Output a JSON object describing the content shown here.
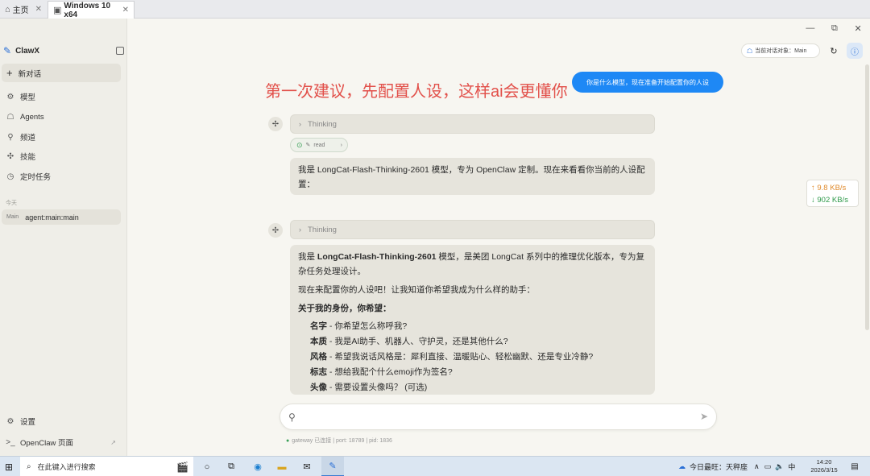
{
  "host_tabs": [
    {
      "label": "主页",
      "icon": "home-icon",
      "close": "✕"
    },
    {
      "label": "Windows 10 x64",
      "icon": "vm-icon",
      "close": "✕"
    }
  ],
  "window": {
    "minimize": "—",
    "restore": "⧉",
    "close": "✕"
  },
  "sidebar": {
    "brand": "ClawX",
    "new_chat": "新对话",
    "nav": [
      {
        "label": "模型",
        "icon": "cpu-icon"
      },
      {
        "label": "Agents",
        "icon": "bot-icon"
      },
      {
        "label": "频道",
        "icon": "network-icon"
      },
      {
        "label": "技能",
        "icon": "puzzle-icon"
      },
      {
        "label": "定时任务",
        "icon": "clock-icon"
      }
    ],
    "section_today": "今天",
    "session": {
      "tag": "Main",
      "label": "agent:main:main"
    },
    "settings": "设置",
    "openclaw_page": "OpenClaw 页面"
  },
  "header": {
    "target_label": "当前对话对象：Main",
    "refresh_icon": "refresh-icon",
    "info_icon": "info-icon"
  },
  "annotation": "第一次建议，先配置人设，这样ai会更懂你",
  "user_message": "你是什么模型，现在准备开始配置你的人设",
  "conversation": {
    "thinking_label": "Thinking",
    "tool_chip": "read",
    "msg1": "我是 LongCat-Flash-Thinking-2601 模型，专为 OpenClaw 定制。现在来看看你当前的人设配置：",
    "msg2": {
      "intro_prefix": "我是 ",
      "intro_model": "LongCat-Flash-Thinking-2601",
      "intro_suffix": " 模型，是美团 LongCat 系列中的推理优化版本，专为复杂任务处理设计。",
      "line2": "现在来配置你的人设吧！让我知道你希望我成为什么样的助手：",
      "heading": "关于我的身份，你希望：",
      "items": [
        {
          "key": "名字",
          "text": " - 你希望怎么称呼我?"
        },
        {
          "key": "本质",
          "text": " - 我是AI助手、机器人、守护灵，还是其他什么?"
        },
        {
          "key": "风格",
          "text": " - 希望我说话风格是：犀利直接、温暖贴心、轻松幽默、还是专业冷静?"
        },
        {
          "key": "标志",
          "text": " - 想给我配个什么emoji作为签名?"
        },
        {
          "key": "头像",
          "text": " - 需要设置头像吗？ (可选)"
        }
      ]
    }
  },
  "speed": {
    "up": "↑ 9.8 KB/s",
    "down": "↓ 902 KB/s"
  },
  "composer": {
    "placeholder": ""
  },
  "gateway_status": "gateway 已连接 | port: 18789 | pid: 1836",
  "taskbar": {
    "search_placeholder": "在此键入进行搜索",
    "weather": "今日最旺：天秤座",
    "ime": "中",
    "time": "14:20",
    "date": "2026/3/15"
  }
}
